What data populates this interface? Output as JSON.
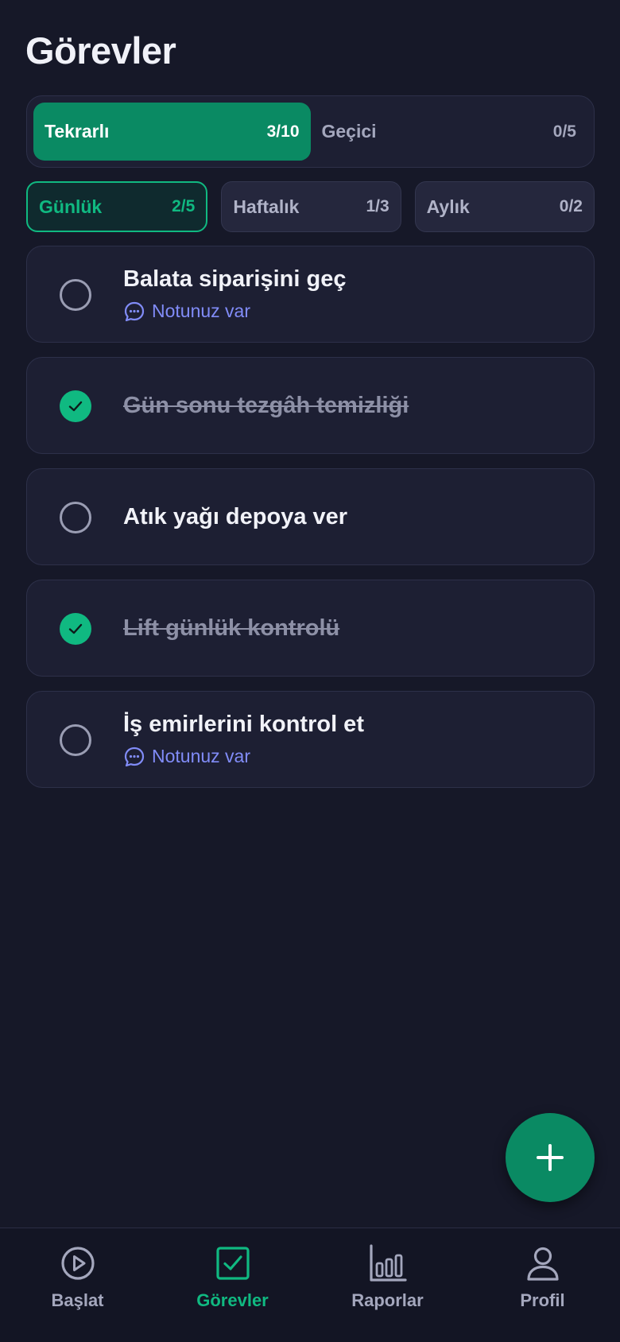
{
  "header": {
    "title": "Görevler"
  },
  "main_tabs": [
    {
      "label": "Tekrarlı",
      "count": "3/10",
      "active": true
    },
    {
      "label": "Geçici",
      "count": "0/5",
      "active": false
    }
  ],
  "sub_tabs": [
    {
      "label": "Günlük",
      "count": "2/5",
      "active": true
    },
    {
      "label": "Haftalık",
      "count": "1/3",
      "active": false
    },
    {
      "label": "Aylık",
      "count": "0/2",
      "active": false
    }
  ],
  "tasks": [
    {
      "title": "Balata siparişini geç",
      "done": false,
      "note": "Notunuz var"
    },
    {
      "title": "Gün sonu tezgâh temizliği",
      "done": true
    },
    {
      "title": "Atık yağı depoya ver",
      "done": false
    },
    {
      "title": "Lift günlük kontrolü",
      "done": true
    },
    {
      "title": "İş emirlerini kontrol et",
      "done": false,
      "note": "Notunuz var"
    }
  ],
  "fab": {
    "icon": "plus-icon"
  },
  "nav": [
    {
      "label": "Başlat",
      "icon": "play-icon",
      "active": false
    },
    {
      "label": "Görevler",
      "icon": "checkbox-icon",
      "active": true
    },
    {
      "label": "Raporlar",
      "icon": "bar-chart-icon",
      "active": false
    },
    {
      "label": "Profil",
      "icon": "user-icon",
      "active": false
    }
  ],
  "colors": {
    "background": "#161828",
    "accent": "#10b981",
    "accent_dark": "#0a8a63",
    "note": "#818cf8"
  }
}
